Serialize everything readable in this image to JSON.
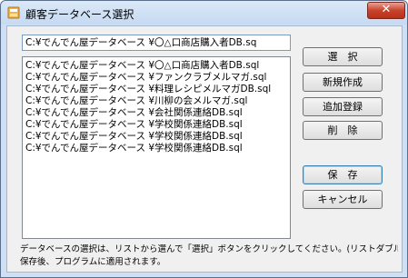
{
  "window": {
    "title": "顧客データベース選択",
    "close_label": "✕"
  },
  "path_field": {
    "value": "C:¥でんでん屋データベース ¥〇△口商店購入者DB.sq"
  },
  "file_list": {
    "items": [
      "C:¥でんでん屋データベース ¥〇△口商店購入者DB.sql",
      "C:¥でんでん屋データベース ¥ファンクラブメルマガ.sql",
      "C:¥でんでん屋データベース ¥料理レシピメルマガDB.sql",
      "C:¥でんでん屋データベース ¥川柳の会メルマガ.sql",
      "C:¥でんでん屋データベース ¥会社関係連絡DB.sql",
      "C:¥でんでん屋データベース ¥学校関係連絡DB.sql",
      "C:¥でんでん屋データベース ¥学校関係連絡DB.sql",
      "C:¥でんでん屋データベース ¥学校関係連絡DB.sql"
    ]
  },
  "buttons": {
    "select": "選　択",
    "new": "新規作成",
    "add": "追加登録",
    "delete": "削　除",
    "save": "保　存",
    "cancel": "キャンセル"
  },
  "footer": {
    "line1": "データベースの選択は、リストから選んで「選択」ボタンをクリックしてください。(リストダブルクリックでも同じ)",
    "line2": "保存後、プログラムに適用されます。"
  },
  "icons": {
    "app": "database-icon"
  }
}
